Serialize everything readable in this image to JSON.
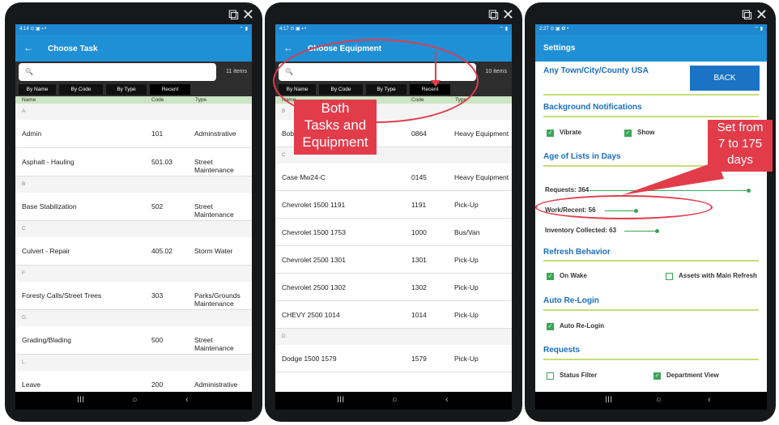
{
  "common": {
    "external_icon": "⧉",
    "close_icon": "✕"
  },
  "nav": {
    "menu": "III",
    "home": "○",
    "back": "‹"
  },
  "p1": {
    "time": "4:14 ⊙ ▣ ▪ •",
    "status_right": "⌔ ▮",
    "back_arrow": "←",
    "title": "Choose Task",
    "search_icon": "🔍",
    "count": "11 items",
    "tabs": [
      "By Name",
      "By Code",
      "By Type",
      "Recent"
    ],
    "cols": [
      "Name",
      "Code",
      "Type"
    ],
    "rows": [
      {
        "section": "A"
      },
      {
        "name": "Admin",
        "code": "101",
        "type": "Adminstrative"
      },
      {
        "name": "Asphalt - Hauling",
        "code": "501.03",
        "type": "Street Maintenance"
      },
      {
        "section": "B"
      },
      {
        "name": "Base Stabilization",
        "code": "502",
        "type": "Street Maintenance"
      },
      {
        "section": "C"
      },
      {
        "name": "Culvert - Repair",
        "code": "405.02",
        "type": "Storm Water"
      },
      {
        "section": "F"
      },
      {
        "name": "Foresty Calls/Street Trees",
        "code": "303",
        "type": "Parks/Grounds Maintenance"
      },
      {
        "section": "G"
      },
      {
        "name": "Grading/Blading",
        "code": "500",
        "type": "Street Maintenance"
      },
      {
        "section": "L"
      },
      {
        "name": "Leave",
        "code": "200",
        "type": "Administrative"
      }
    ]
  },
  "p2": {
    "time": "4:17 ⊙ ▣ ▪ •",
    "status_right": "⌔ ▮",
    "back_arrow": "←",
    "title": "Choose Equipment",
    "search_icon": "🔍",
    "count": "10 items",
    "tabs": [
      "By Name",
      "By Code",
      "By Type",
      "Recent"
    ],
    "cols": [
      "Name",
      "Code",
      "Type"
    ],
    "callout": [
      "Both",
      "Tasks and",
      "Equipment"
    ],
    "rows": [
      {
        "section": "B"
      },
      {
        "name": "Bobcat",
        "code": "0864",
        "type": "Heavy Equipment"
      },
      {
        "section": "C"
      },
      {
        "name": "Case Mw24-C",
        "code": "0145",
        "type": "Heavy Equipment"
      },
      {
        "name": "Chevrolet 1500 1191",
        "code": "1191",
        "type": "Pick-Up"
      },
      {
        "name": "Chevrolet 1500 1753",
        "code": "1000",
        "type": "Bus/Van"
      },
      {
        "name": "Chevrolet 2500 1301",
        "code": "1301",
        "type": "Pick-Up"
      },
      {
        "name": "Chevrolet 2500 1302",
        "code": "1302",
        "type": "Pick-Up"
      },
      {
        "name": "CHEVY 2500 1014",
        "code": "1014",
        "type": "Pick-Up"
      },
      {
        "section": "D"
      },
      {
        "name": "Dodge 1500 1579",
        "code": "1579",
        "type": "Pick-Up"
      }
    ]
  },
  "p3": {
    "time": "2:27 ⊙ ▣ ✿ •",
    "status_right": "⌔ ▮",
    "title": "Settings",
    "location": "Any Town/City/County USA",
    "back_button": "BACK",
    "callout": [
      "Set from",
      "7 to 175",
      "days"
    ],
    "bg_title": "Background Notifications",
    "vibrate": "Vibrate",
    "show": "Show",
    "age_title": "Age of Lists in Days",
    "requests": "Requests:  364",
    "work": "Work/Recent:  56",
    "inventory": "Inventory Collected:  63",
    "refresh_title": "Refresh Behavior",
    "on_wake": "On Wake",
    "assets": "Assets with Main Refresh",
    "relogin_title": "Auto Re-Login",
    "auto_relogin": "Auto Re-Login",
    "requests_title": "Requests",
    "status_filter": "Status Filter",
    "dept_view": "Department View",
    "check": "✓",
    "sliders": {
      "requests": 0.94,
      "work": 0.3,
      "inventory": 0.32
    }
  }
}
